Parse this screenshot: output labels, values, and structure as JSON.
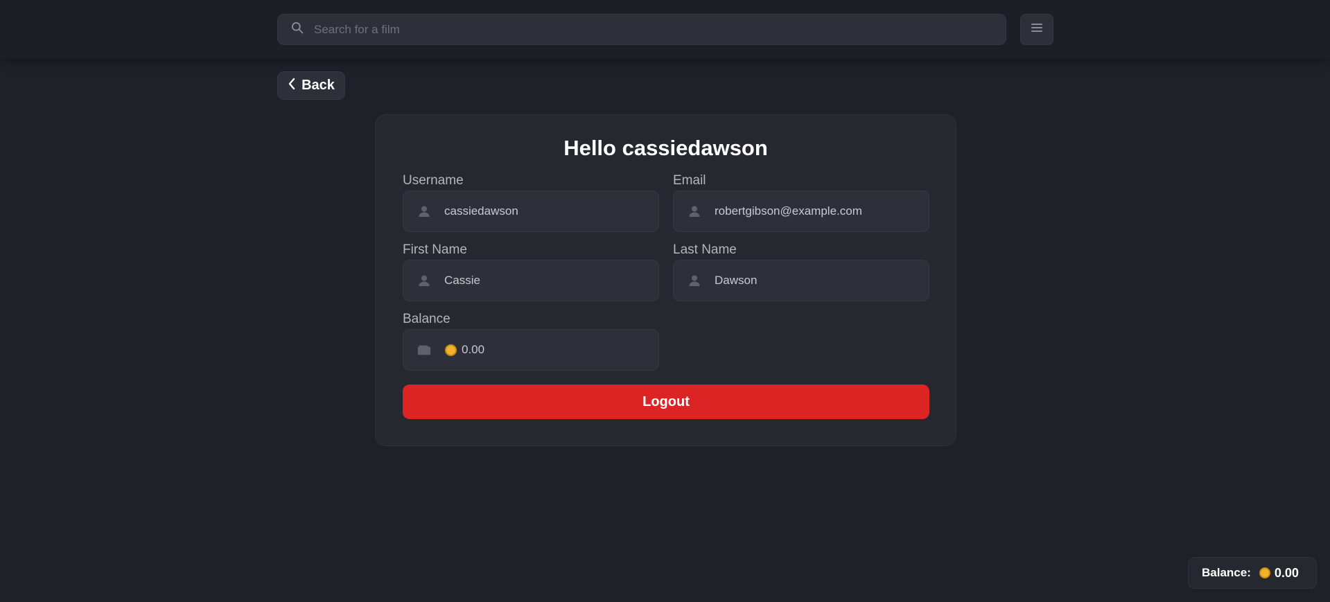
{
  "search": {
    "placeholder": "Search for a film"
  },
  "nav": {
    "back_label": "Back"
  },
  "profile": {
    "title": "Hello cassiedawson",
    "fields": {
      "username": {
        "label": "Username",
        "value": "cassiedawson",
        "icon": "user-icon"
      },
      "email": {
        "label": "Email",
        "value": "robertgibson@example.com",
        "icon": "user-icon"
      },
      "first_name": {
        "label": "First Name",
        "value": "Cassie",
        "icon": "user-icon"
      },
      "last_name": {
        "label": "Last Name",
        "value": "Dawson",
        "icon": "user-icon"
      },
      "balance": {
        "label": "Balance",
        "value": "0.00",
        "icon": "wallet-icon"
      }
    },
    "logout_label": "Logout"
  },
  "balance_chip": {
    "label": "Balance:",
    "amount": "0.00"
  },
  "colors": {
    "background": "#1f2129",
    "card": "#262830",
    "accent_logout": "#dc2424",
    "coin": "#f0b32b"
  }
}
